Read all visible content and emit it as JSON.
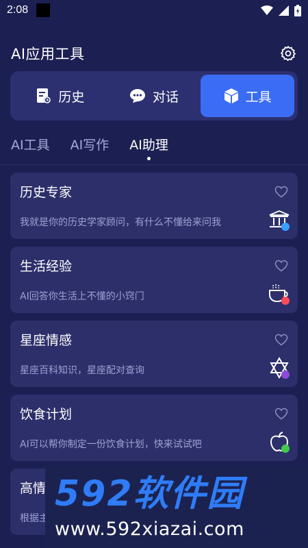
{
  "status_bar": {
    "time": "2:08"
  },
  "header": {
    "title": "AI应用工具"
  },
  "segment": [
    {
      "label": "历史",
      "icon": "history-doc-icon",
      "active": false
    },
    {
      "label": "对话",
      "icon": "chat-bubble-icon",
      "active": false
    },
    {
      "label": "工具",
      "icon": "cube-icon",
      "active": true
    }
  ],
  "subtabs": [
    {
      "label": "AI工具",
      "active": false
    },
    {
      "label": "AI写作",
      "active": false
    },
    {
      "label": "AI助理",
      "active": true
    }
  ],
  "cards": [
    {
      "title": "历史专家",
      "desc": "我就是你的历史学家顾问，有什么不懂给来问我",
      "icon": "temple-icon",
      "badge_color": "#3aa0ff"
    },
    {
      "title": "生活经验",
      "desc": "AI回答你生活上不懂的小窍门",
      "icon": "teacup-icon",
      "badge_color": "#ff4a5a"
    },
    {
      "title": "星座情感",
      "desc": "星座百科知识，星座配对查询",
      "icon": "star-of-david-icon",
      "badge_color": "#8f4ad9"
    },
    {
      "title": "饮食计划",
      "desc": "AI可以帮你制定一份饮食计划，快来试试吧",
      "icon": "apple-icon",
      "badge_color": "#43c94a"
    },
    {
      "title": "高情",
      "desc": "根据主",
      "icon": "",
      "badge_color": ""
    }
  ],
  "watermark": {
    "brand": "592软件园",
    "url": "www.592xiazai.com"
  },
  "colors": {
    "background": "#1c1f52",
    "card": "#2c2f6a",
    "accent": "#3b6cf5",
    "muted_text": "#9ea2d2"
  }
}
